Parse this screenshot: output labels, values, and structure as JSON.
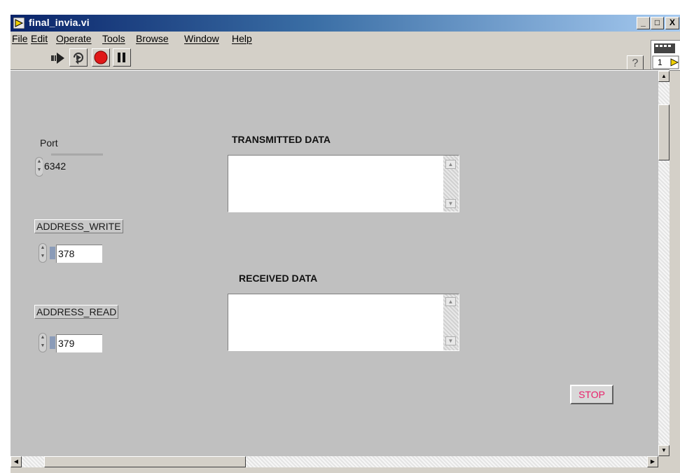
{
  "window": {
    "title": "final_invia.vi",
    "minimize_glyph": "_",
    "maximize_glyph": "□",
    "close_glyph": "X"
  },
  "menu": [
    "File",
    "Edit",
    "Operate",
    "Tools",
    "Browse",
    "Window",
    "Help"
  ],
  "toolbar": {
    "icons": [
      "run-arrow-icon",
      "run-continuously-icon",
      "abort-icon",
      "pause-icon"
    ],
    "help_glyph": "?",
    "vi_icon_number": "1"
  },
  "panel": {
    "port": {
      "label": "Port",
      "value": "6342"
    },
    "address_write": {
      "label": "ADDRESS_WRITE",
      "value": "378"
    },
    "address_read": {
      "label": "ADDRESS_READ",
      "value": "379"
    },
    "transmitted": {
      "label": "TRANSMITTED DATA",
      "value": ""
    },
    "received": {
      "label": "RECEIVED  DATA",
      "value": ""
    },
    "stop_label": "STOP"
  },
  "colors": {
    "title_start": "#0a246a",
    "title_end": "#a6caf0",
    "panel_bg": "#c0c0c0",
    "stop_text": "#e8206a",
    "abort_red": "#e01818"
  }
}
